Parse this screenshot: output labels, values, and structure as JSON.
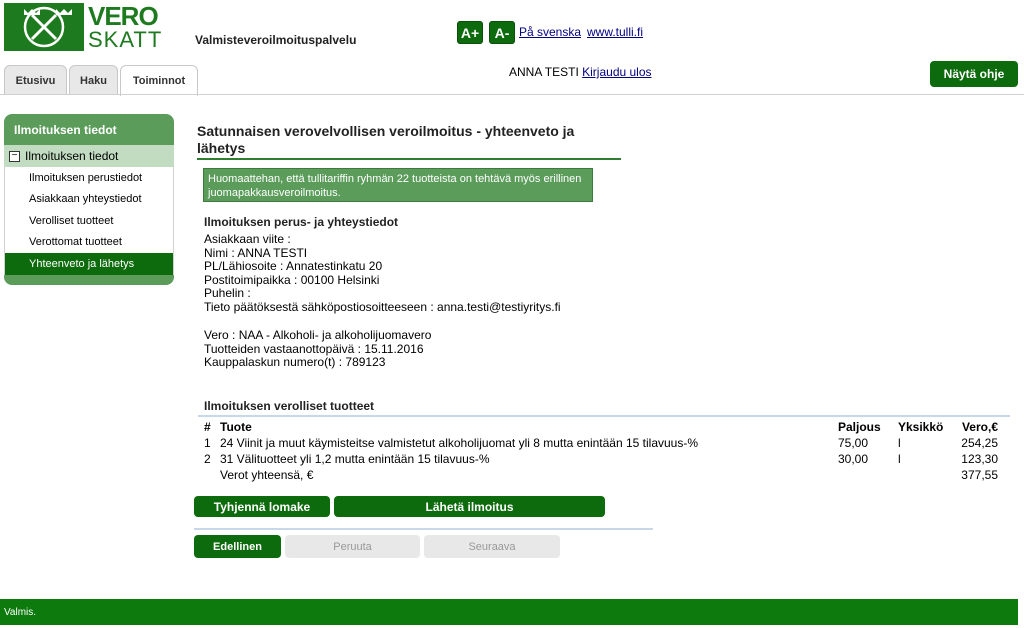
{
  "header": {
    "logo_line1": "VERO",
    "logo_line2": "SKATT",
    "service_name": "Valmisteveroilmoituspalvelu",
    "font_increase": "A+",
    "font_decrease": "A-",
    "language_link": "På svenska",
    "tulli_link": "www.tulli.fi"
  },
  "tabs": [
    {
      "label": "Etusivu"
    },
    {
      "label": "Haku"
    },
    {
      "label": "Toiminnot"
    }
  ],
  "user": {
    "name": "ANNA TESTI",
    "logout": "Kirjaudu ulos"
  },
  "help_button": "Näytä ohje",
  "sidebar": {
    "header": "Ilmoituksen tiedot",
    "group": "Ilmoituksen tiedot",
    "group_toggle": "−",
    "items": [
      {
        "label": "Ilmoituksen perustiedot"
      },
      {
        "label": "Asiakkaan yhteystiedot"
      },
      {
        "label": "Verolliset tuotteet"
      },
      {
        "label": "Verottomat tuotteet"
      },
      {
        "label": "Yhteenveto ja lähetys"
      }
    ]
  },
  "main": {
    "title": "Satunnaisen verovelvollisen veroilmoitus - yhteenveto ja lähetys",
    "notice": "Huomaattehan, että tullitariffin ryhmän 22 tuotteista on tehtävä myös erillinen juomapakkausveroilmoitus.",
    "basic_heading": "Ilmoituksen perus- ja yhteystiedot",
    "basic_lines": [
      "Asiakkaan viite :",
      "Nimi : ANNA TESTI",
      "PL/Lähiosoite : Annatestinkatu 20",
      "Postitoimipaikka : 00100 Helsinki",
      "Puhelin :",
      "Tieto päätöksestä sähköpostiosoitteeseen : anna.testi@testiyritys.fi"
    ],
    "tax_lines": [
      "Vero : NAA - Alkoholi- ja alkoholijuomavero",
      "Tuotteiden vastaanottopäivä : 15.11.2016",
      "Kauppalaskun numero(t) : 789123"
    ],
    "products_heading": "Ilmoituksen verolliset tuotteet",
    "table_headers": {
      "num": "#",
      "product": "Tuote",
      "qty": "Paljous",
      "unit": "Yksikkö",
      "tax": "Vero,€"
    },
    "products": [
      {
        "num": "1",
        "product": "24 Viinit ja muut käymisteitse valmistetut alkoholijuomat yli 8 mutta enintään 15 tilavuus-%",
        "qty": "75,00",
        "unit": "l",
        "tax": "254,25"
      },
      {
        "num": "2",
        "product": "31 Välituotteet yli 1,2 mutta enintään 15 tilavuus-%",
        "qty": "30,00",
        "unit": "l",
        "tax": "123,30"
      }
    ],
    "total_label": "Verot yhteensä, €",
    "total_value": "377,55"
  },
  "buttons": {
    "clear": "Tyhjennä lomake",
    "send": "Lähetä ilmoitus",
    "previous": "Edellinen",
    "cancel": "Peruuta",
    "next": "Seuraava"
  },
  "status": "Valmis.",
  "colors": {
    "brand_green": "#0d6b0d",
    "light_green": "#5b9c5b",
    "pale_green": "#c1dcc1"
  }
}
